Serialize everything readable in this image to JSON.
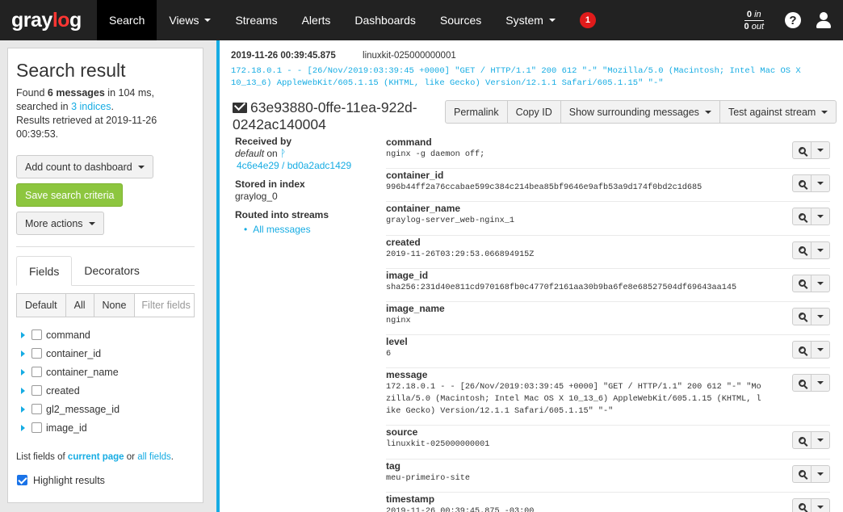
{
  "nav": {
    "logo_prefix": "gray",
    "logo_o": "lo",
    "logo_suffix": "g",
    "items": [
      "Search",
      "Views",
      "Streams",
      "Alerts",
      "Dashboards",
      "Sources",
      "System"
    ],
    "notification_count": "1",
    "throughput_in": "0",
    "throughput_in_label": "in",
    "throughput_out": "0",
    "throughput_out_label": "out",
    "help_glyph": "?"
  },
  "sidebar": {
    "title": "Search result",
    "found_prefix": "Found ",
    "found_count": "6 messages",
    "found_suffix": " in 104 ms,",
    "searched_prefix": "searched in ",
    "indices_link": "3 indices",
    "searched_suffix": ".",
    "retrieved": "Results retrieved at 2019-11-26 00:39:53.",
    "add_count_label": "Add count to dashboard",
    "save_search_label": "Save search criteria",
    "more_actions_label": "More actions",
    "tabs": [
      "Fields",
      "Decorators"
    ],
    "filter_buttons": [
      "Default",
      "All",
      "None"
    ],
    "filter_placeholder": "Filter fields",
    "field_list": [
      "command",
      "container_id",
      "container_name",
      "created",
      "gl2_message_id",
      "image_id"
    ],
    "list_fields_prefix": "List fields of ",
    "current_page_link": "current page",
    "or_text": " or ",
    "all_fields_link": "all fields",
    "list_fields_suffix": ".",
    "highlight_label": "Highlight results"
  },
  "message": {
    "timestamp": "2019-11-26 00:39:45.875",
    "source": "linuxkit-025000000001",
    "full_message": "172.18.0.1 - - [26/Nov/2019:03:39:45 +0000] \"GET / HTTP/1.1\" 200 612 \"-\" \"Mozilla/5.0 (Macintosh; Intel Mac OS X 10_13_6) AppleWebKit/605.1.15 (KHTML, like Gecko) Version/12.1.1 Safari/605.1.15\" \"-\"",
    "id": "63e93880-0ffe-11ea-922d-0242ac140004",
    "actions": [
      "Permalink",
      "Copy ID",
      "Show surrounding messages",
      "Test against stream"
    ],
    "received_by_label": "Received by",
    "received_input": "default",
    "received_on": " on ",
    "received_nodes": "4c6e4e29 / bd0a2adc1429",
    "stored_label": "Stored in index",
    "stored_index": "graylog_0",
    "routed_label": "Routed into streams",
    "streams": [
      "All messages"
    ],
    "fields": [
      {
        "name": "command",
        "value": "nginx -g daemon off;"
      },
      {
        "name": "container_id",
        "value": "996b44ff2a76ccabae599c384c214bea85bf9646e9afb53a9d174f0bd2c1d685"
      },
      {
        "name": "container_name",
        "value": "graylog-server_web-nginx_1"
      },
      {
        "name": "created",
        "value": "2019-11-26T03:29:53.066894915Z"
      },
      {
        "name": "image_id",
        "value": "sha256:231d40e811cd970168fb0c4770f2161aa30b9ba6fe8e68527504df69643aa145"
      },
      {
        "name": "image_name",
        "value": "nginx"
      },
      {
        "name": "level",
        "value": "6"
      },
      {
        "name": "message",
        "value": "172.18.0.1 - - [26/Nov/2019:03:39:45 +0000] \"GET / HTTP/1.1\" 200 612 \"-\" \"Mozilla/5.0 (Macintosh; Intel Mac OS X 10_13_6) AppleWebKit/605.1.15 (KHTML, like Gecko) Version/12.1.1 Safari/605.1.15\" \"-\""
      },
      {
        "name": "source",
        "value": "linuxkit-025000000001"
      },
      {
        "name": "tag",
        "value": "meu-primeiro-site"
      },
      {
        "name": "timestamp",
        "value": "2019-11-26 00:39:45.875 -03:00"
      }
    ]
  },
  "colors": {
    "accent": "#16ace3",
    "brand_red": "#ff3633",
    "success": "#8dc63f",
    "navbar": "#222222"
  }
}
